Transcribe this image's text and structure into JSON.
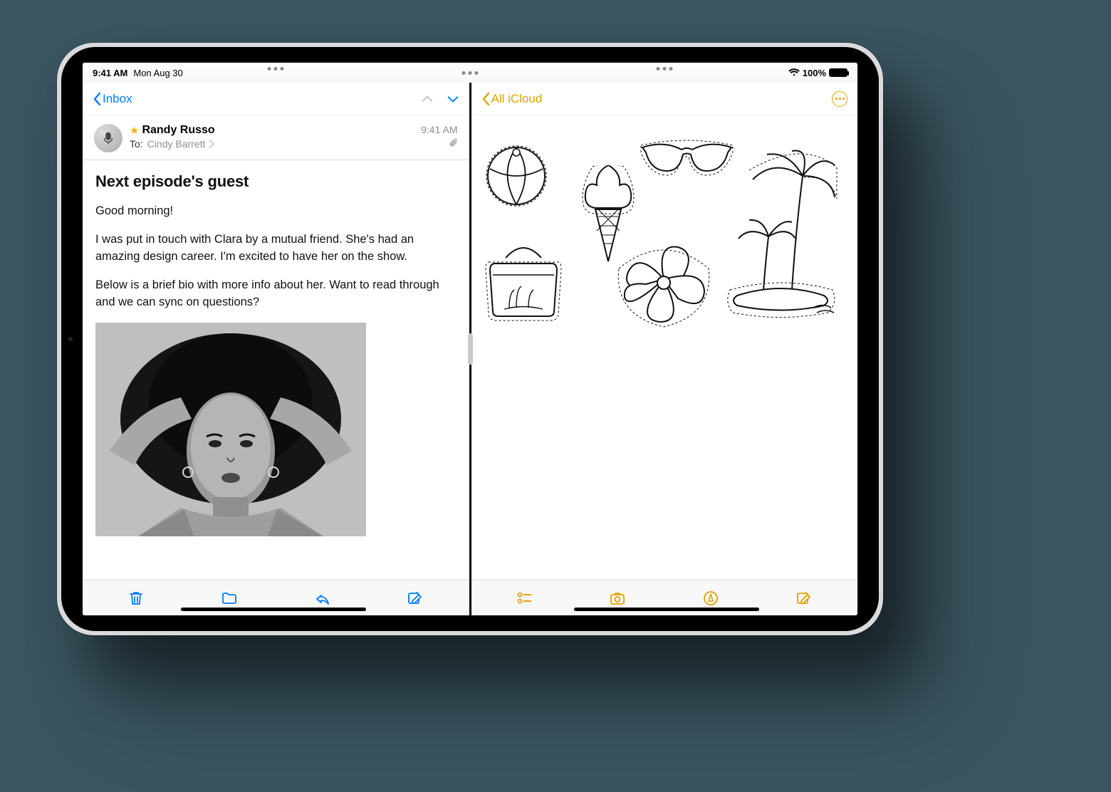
{
  "statusbar": {
    "time": "9:41 AM",
    "date": "Mon Aug 30",
    "battery_pct": "100%"
  },
  "mail": {
    "nav": {
      "back": "Inbox"
    },
    "header": {
      "sender": "Randy Russo",
      "to_label": "To:",
      "recipient": "Cindy Barrett",
      "time": "9:41 AM",
      "has_attachment": true,
      "starred": true
    },
    "subject": "Next episode's guest",
    "paragraphs": [
      "Good morning!",
      "I was put in touch with Clara by a mutual friend. She's had an amazing design career. I'm excited to have her on the show.",
      "Below is a brief bio with more info about her. Want to read through and we can sync on questions?"
    ],
    "toolbar": [
      "trash",
      "folder",
      "reply",
      "compose"
    ]
  },
  "notes": {
    "nav": {
      "back": "All iCloud"
    },
    "sketches": [
      "beach-ball",
      "ice-cream-cone",
      "sunglasses",
      "tote-bag",
      "hibiscus-flower",
      "palm-tree-island"
    ],
    "toolbar": [
      "checklist",
      "camera",
      "markup",
      "compose"
    ]
  },
  "colors": {
    "mail_accent": "#007aff",
    "notes_accent": "#e3a100"
  }
}
